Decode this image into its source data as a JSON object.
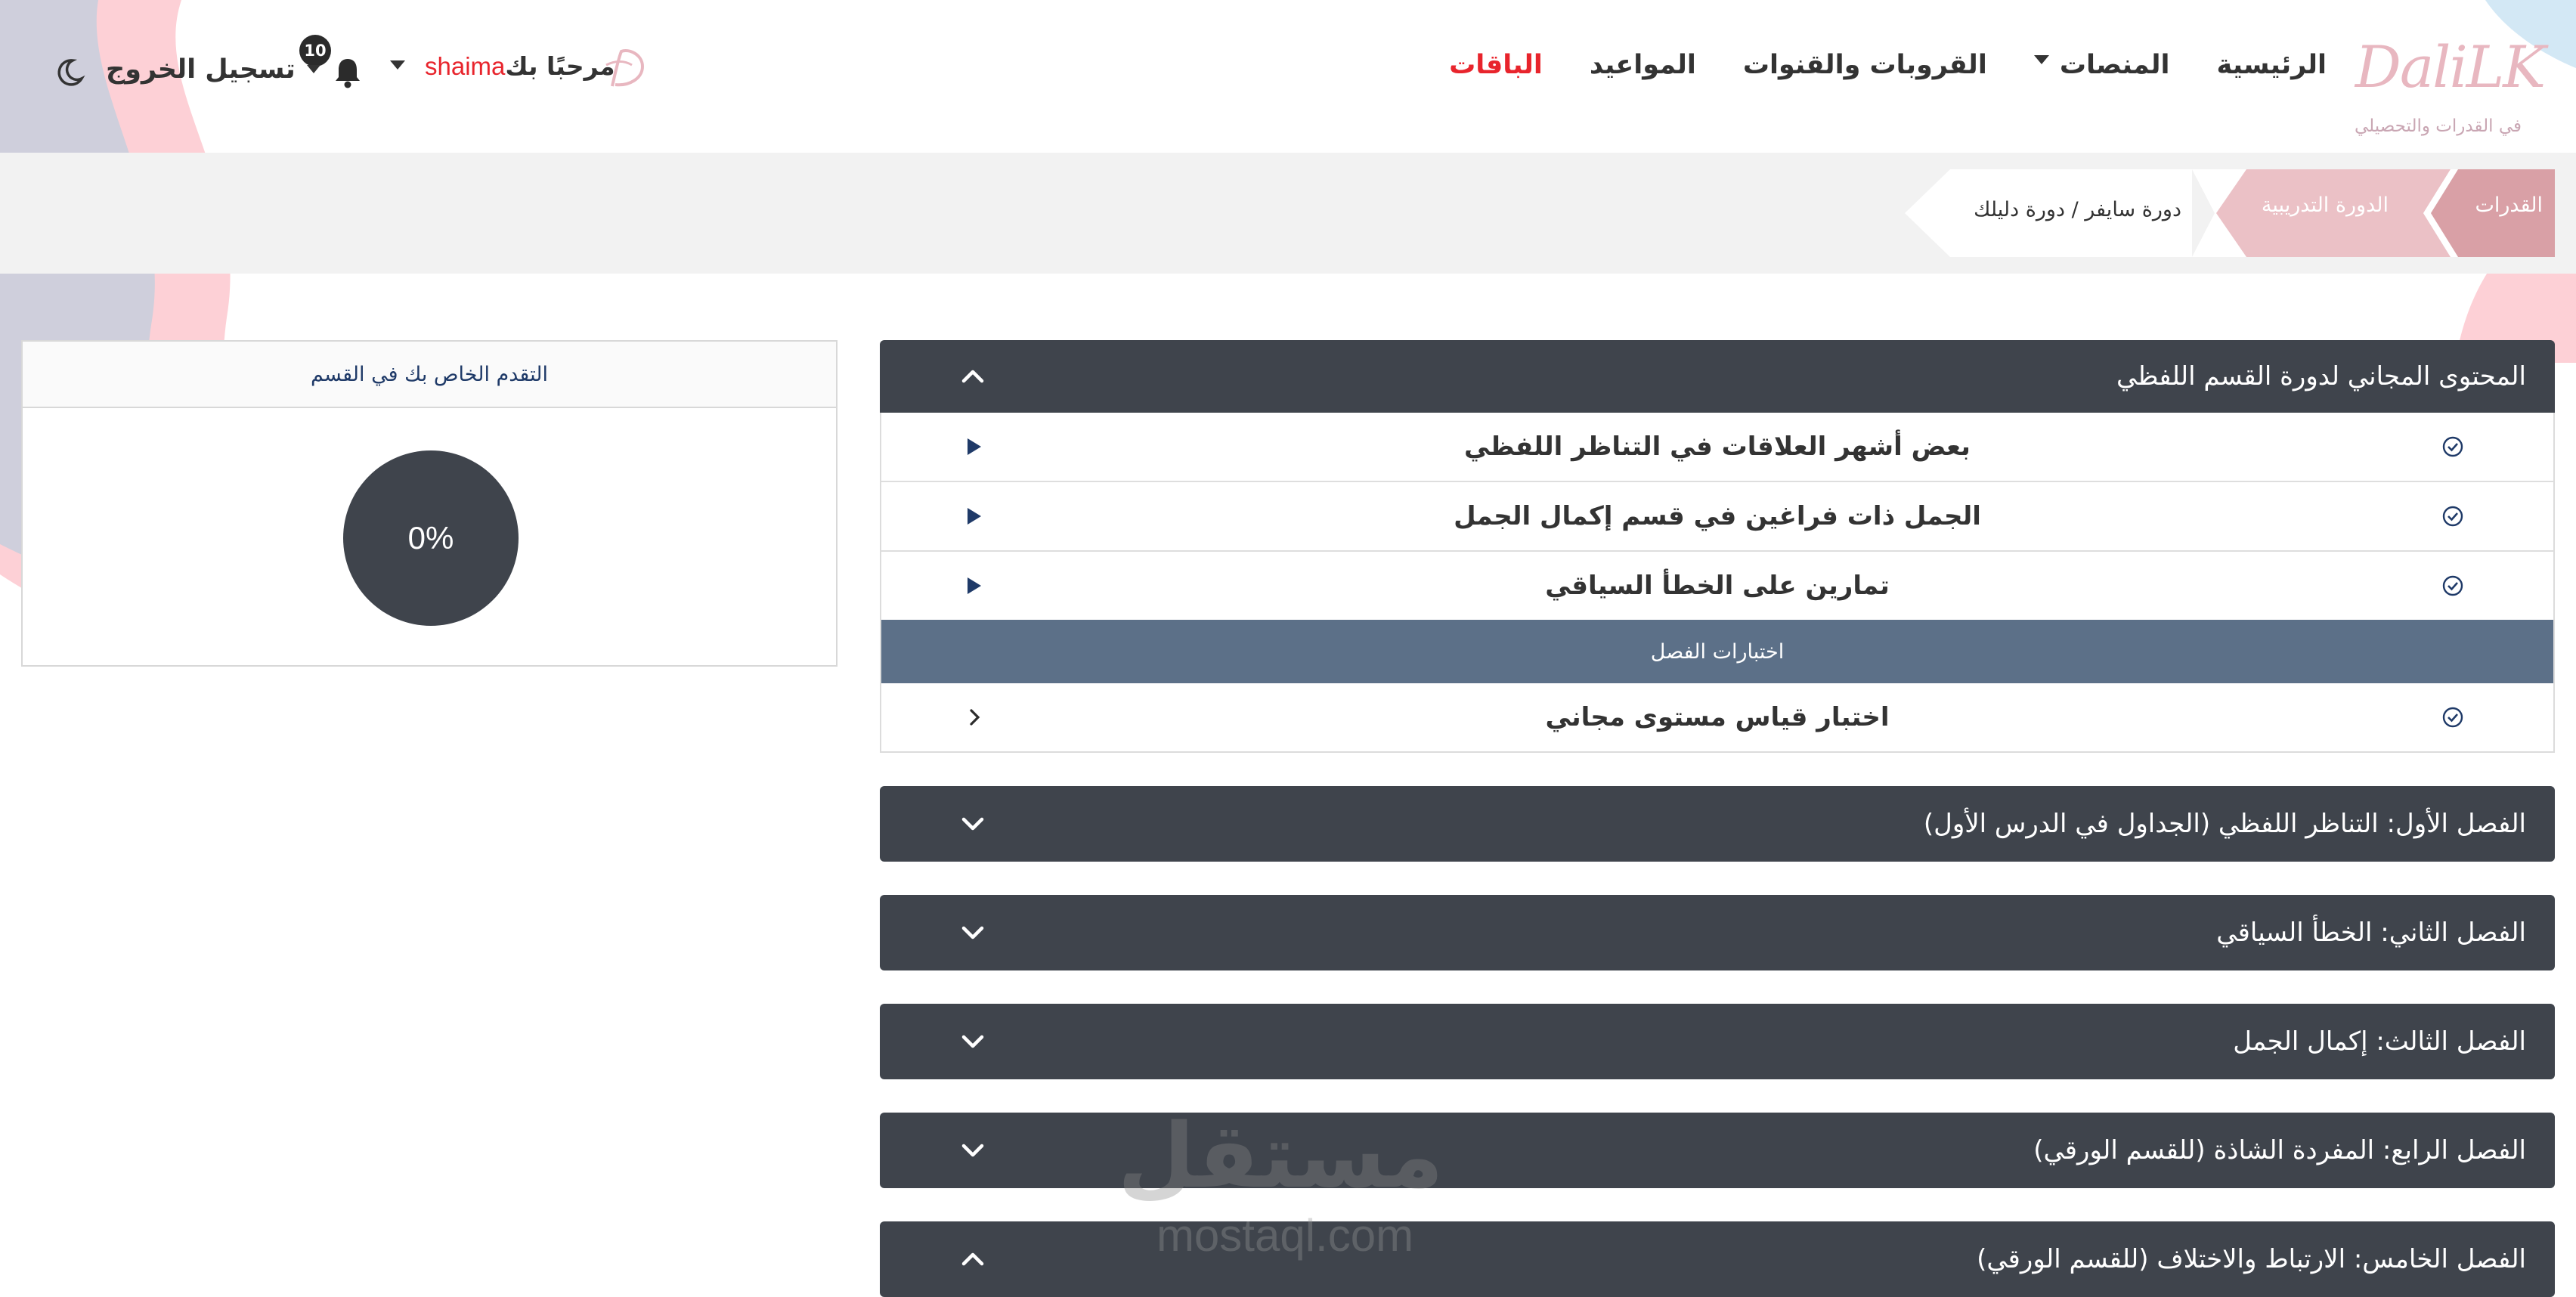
{
  "brand": {
    "logo_word": "DaliLK",
    "logo_subtitle": "في القدرات والتحصيلي"
  },
  "nav": {
    "items": [
      {
        "label": "الرئيسية",
        "has_dropdown": false
      },
      {
        "label": "المنصات",
        "has_dropdown": true
      },
      {
        "label": "القروبات والقنوات",
        "has_dropdown": false
      },
      {
        "label": "المواعيد",
        "has_dropdown": false
      },
      {
        "label": "الباقات",
        "has_dropdown": false,
        "highlight": true
      }
    ]
  },
  "user": {
    "greeting": "مرحبًا بك",
    "username": "shaima",
    "notifications_count": "10",
    "logout_label": "تسجيل الخروج"
  },
  "breadcrumb": {
    "items": [
      "القدرات",
      "الدورة التدريبية",
      "دورة سايفر / دورة دليلك"
    ]
  },
  "accordion": {
    "open_section": {
      "title": "المحتوى المجاني لدورة القسم اللفظي",
      "lessons": [
        "بعض أشهر العلاقات في التناظر اللفظي",
        "الجمل ذات فراغين في قسم إكمال الجمل",
        "تمارين على الخطأ السياقي"
      ],
      "tests_header": "اختبارات الفصل",
      "tests": [
        "اختبار قياس مستوى مجاني"
      ]
    },
    "chapters": [
      {
        "title": "الفصل الأول: التناظر اللفظي (الجداول في الدرس الأول)",
        "state": "collapsed"
      },
      {
        "title": "الفصل الثاني: الخطأ السياقي",
        "state": "collapsed"
      },
      {
        "title": "الفصل الثالث: إكمال الجمل",
        "state": "collapsed"
      },
      {
        "title": "الفصل الرابع: المفردة الشاذة (للقسم الورقي)",
        "state": "collapsed"
      },
      {
        "title": "الفصل الخامس: الارتباط والاختلاف (للقسم الورقي)",
        "state": "expanded"
      }
    ]
  },
  "progress": {
    "title": "التقدم الخاص بك في القسم",
    "value_label": "0%",
    "value": 0
  },
  "watermark": {
    "arabic": "مستقل",
    "latin": "mostaql.com"
  },
  "colors": {
    "accent_red": "#e8242c",
    "dark_panel": "#3f444c",
    "section_bar": "#5c7088",
    "breadcrumb_pink": "#d9a0a6"
  }
}
